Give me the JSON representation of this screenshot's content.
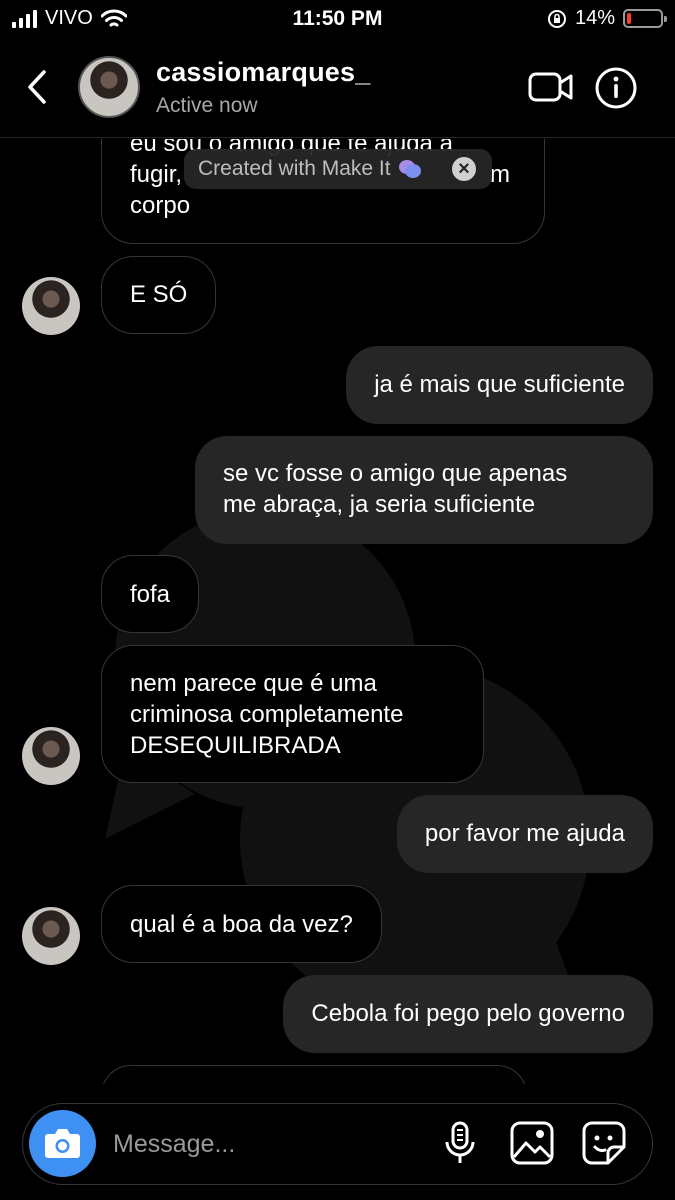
{
  "status_bar": {
    "carrier": "VIVO",
    "time": "11:50 PM",
    "battery_percent": "14%",
    "battery_level": 0.14,
    "icons": [
      "signal-icon",
      "wifi-icon",
      "orientation-lock-icon",
      "battery-icon"
    ]
  },
  "header": {
    "username": "cassiomarques_",
    "status": "Active now",
    "icons": [
      "back-icon",
      "video-call-icon",
      "info-icon"
    ]
  },
  "watermark": {
    "text": "Created with Make It",
    "icons": [
      "chat-bubbles-icon",
      "close-icon"
    ]
  },
  "messages": [
    {
      "direction": "in",
      "lines": [
        "eu sou o amigo que te ajuda a",
        "fugir, ",
        "corpo"
      ],
      "line_tail": "m"
    },
    {
      "direction": "in",
      "text": "E SÓ",
      "avatar": true
    },
    {
      "direction": "out",
      "text": "ja é mais que suficiente"
    },
    {
      "direction": "out",
      "lines": [
        "se vc fosse o amigo que apenas",
        "me abraça, ja seria suficiente"
      ]
    },
    {
      "direction": "in",
      "text": "fofa"
    },
    {
      "direction": "in",
      "lines": [
        "nem parece que é uma",
        "criminosa completamente",
        "DESEQUILIBRADA"
      ],
      "avatar": true
    },
    {
      "direction": "out",
      "text": "por favor me ajuda"
    },
    {
      "direction": "in",
      "text": "qual é a boa da vez?",
      "avatar": true
    },
    {
      "direction": "out",
      "text": "Cebola foi pego pelo governo"
    }
  ],
  "composer": {
    "placeholder": "Message...",
    "icons": [
      "camera-icon",
      "microphone-icon",
      "gallery-icon",
      "sticker-icon"
    ]
  },
  "colors": {
    "background": "#000000",
    "outgoing_bubble": "#262626",
    "incoming_border": "#363636",
    "camera_button": "#3e91f2",
    "secondary_text": "#a8a8a8",
    "battery_low": "#ff3b30"
  }
}
